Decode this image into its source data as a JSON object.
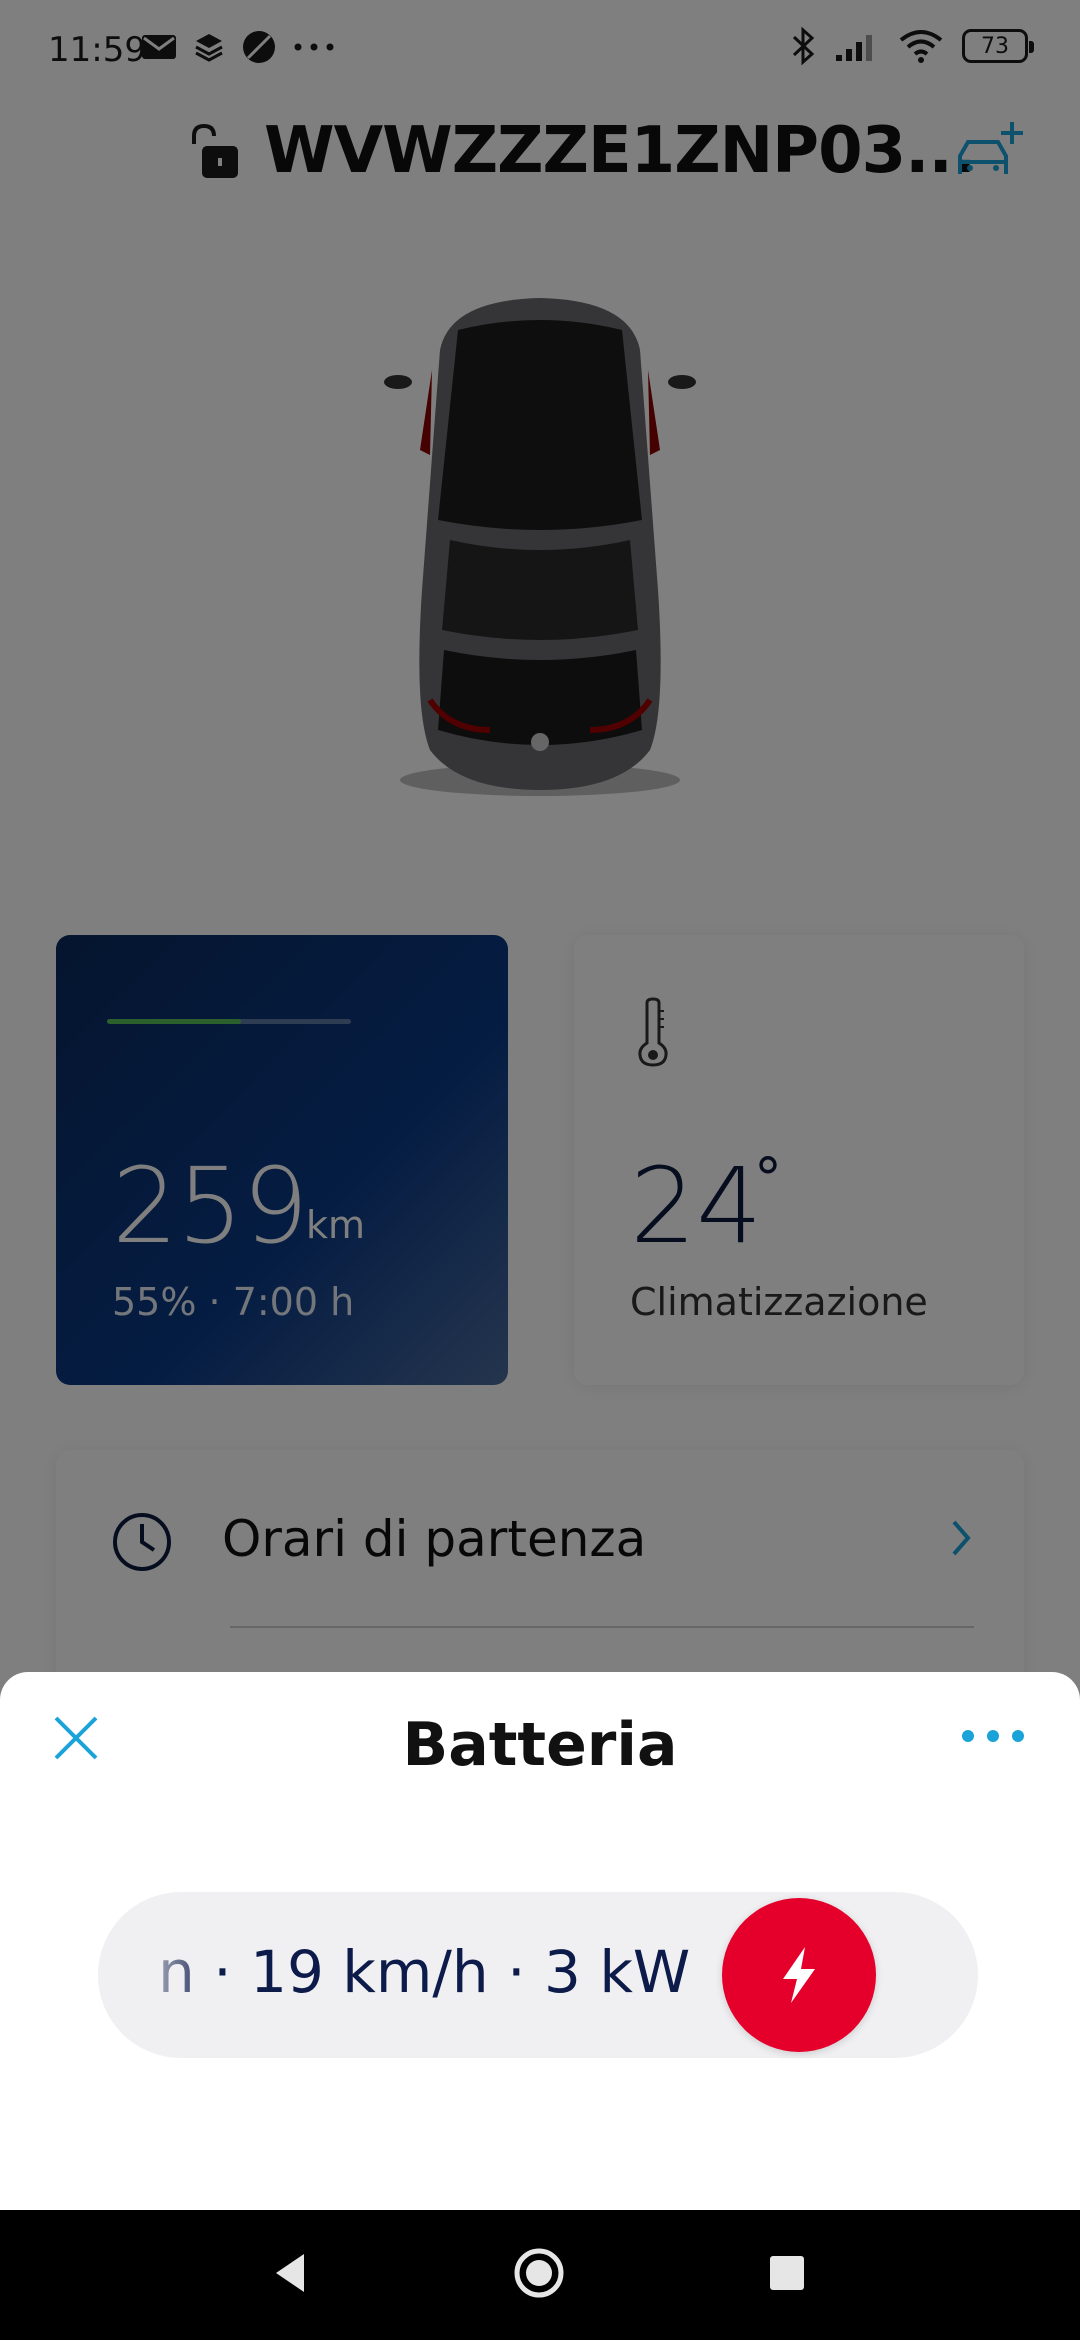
{
  "status_bar": {
    "time": "11:59",
    "battery_level": "73",
    "left_icons": [
      "mail-icon",
      "layers-icon",
      "globe-icon",
      "more-dots-icon"
    ],
    "right_icons": [
      "bluetooth-icon",
      "signal-icon",
      "wifi-icon",
      "battery-icon"
    ]
  },
  "header": {
    "vehicle_id": "WVWZZZE1ZNP03...",
    "lock_icon": "unlocked-lock-icon",
    "add_icon": "add-car-icon"
  },
  "range_card": {
    "value": "259",
    "unit": "km",
    "subtitle": "55% · 7:00 h",
    "battery_fraction": 0.55,
    "accent": "#57c05a"
  },
  "climate_card": {
    "value": "24",
    "degree": "°",
    "label": "Climatizzazione"
  },
  "list": {
    "items": [
      {
        "label": "Orari di partenza",
        "icon": "clock-icon"
      }
    ]
  },
  "sheet": {
    "title": "Batteria",
    "charging_info": "n · 19 km/h · 3 kW",
    "charge_button_color": "#e4002b",
    "accent": "#1aa3d9"
  }
}
